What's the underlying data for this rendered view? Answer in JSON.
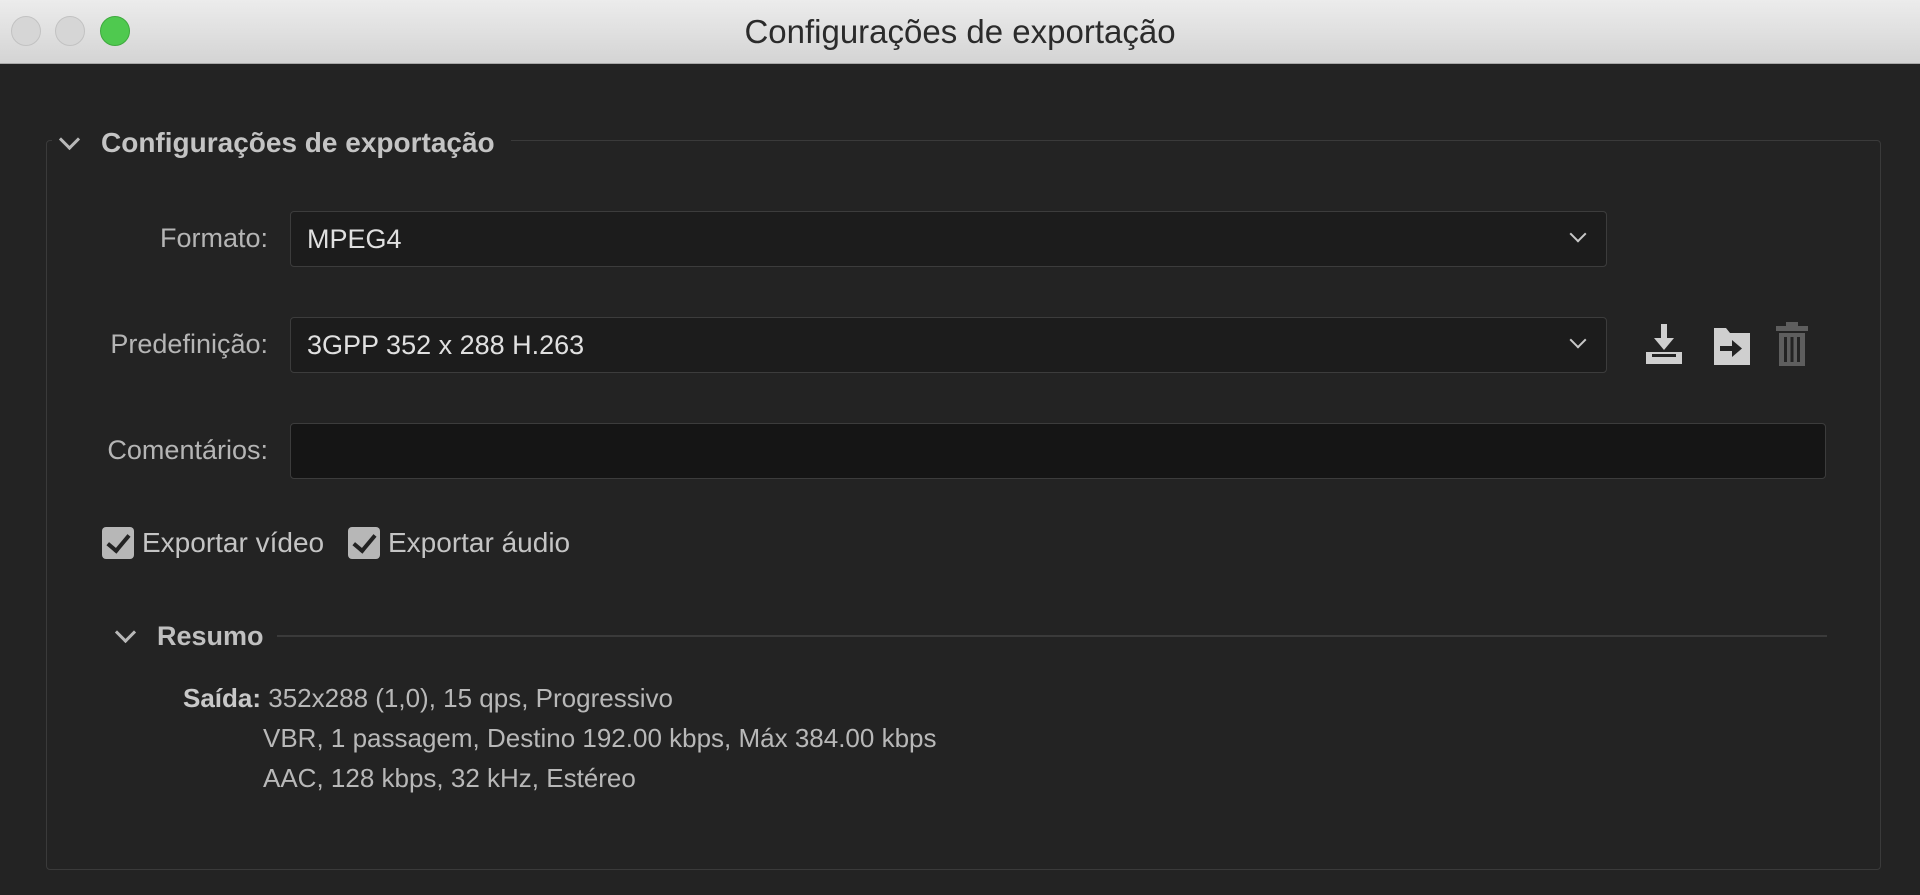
{
  "window": {
    "title": "Configurações de exportação"
  },
  "section": {
    "title": "Configurações de exportação"
  },
  "format": {
    "label": "Formato:",
    "value": "MPEG4"
  },
  "preset": {
    "label": "Predefinição:",
    "value": "3GPP 352 x 288 H.263"
  },
  "comments": {
    "label": "Comentários:",
    "value": ""
  },
  "checkboxes": {
    "video": {
      "label": "Exportar vídeo",
      "checked": true
    },
    "audio": {
      "label": "Exportar áudio",
      "checked": true
    }
  },
  "summary": {
    "title": "Resumo",
    "output_key": "Saída:",
    "lines": [
      "352x288 (1,0), 15 qps, Progressivo",
      "VBR, 1 passagem, Destino 192.00 kbps, Máx 384.00 kbps",
      "AAC, 128 kbps, 32 kHz, Estéreo"
    ]
  },
  "icons": [
    "save-preset-icon",
    "import-preset-icon",
    "delete-preset-icon"
  ]
}
